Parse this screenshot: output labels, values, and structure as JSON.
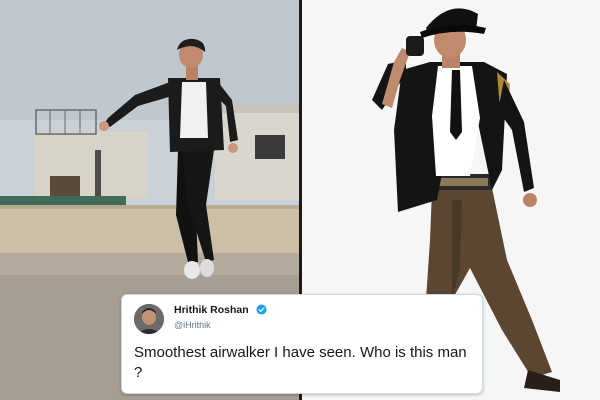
{
  "tweet": {
    "name": "Hrithik Roshan",
    "handle": "@iHrithik",
    "text": "Smoothest airwalker I have seen. Who is this man ?",
    "verified_color": "#1da1f2"
  },
  "colors": {
    "sky": "#c9d1d6",
    "wall": "#cdbfa6",
    "studio_bg": "#f6f6f6"
  },
  "icons": [
    "verified-badge-icon"
  ]
}
